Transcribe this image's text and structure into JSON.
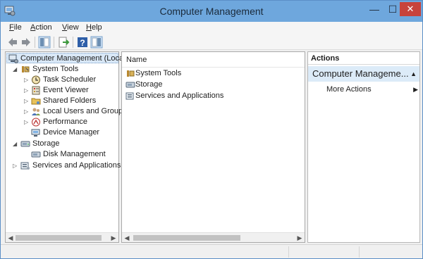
{
  "window": {
    "title": "Computer Management"
  },
  "window_controls": {
    "minimize": "—",
    "maximize": "☐",
    "close": "✕"
  },
  "menu": [
    {
      "label": "File",
      "key": "F",
      "rest": "ile"
    },
    {
      "label": "Action",
      "key": "A",
      "rest": "ction"
    },
    {
      "label": "View",
      "key": "V",
      "rest": "iew"
    },
    {
      "label": "Help",
      "key": "H",
      "rest": "elp"
    }
  ],
  "toolbar": {
    "icons": [
      "back-arrow-icon",
      "forward-arrow-icon",
      "show-hide-tree-icon",
      "export-list-icon",
      "help-icon",
      "show-hide-action-pane-icon"
    ]
  },
  "tree": {
    "root": "Computer Management (Local",
    "system_tools": "System Tools",
    "task_scheduler": "Task Scheduler",
    "event_viewer": "Event Viewer",
    "shared_folders": "Shared Folders",
    "local_users": "Local Users and Groups",
    "performance": "Performance",
    "device_manager": "Device Manager",
    "storage": "Storage",
    "disk_management": "Disk Management",
    "services": "Services and Applications"
  },
  "list": {
    "column_header": "Name",
    "items": [
      "System Tools",
      "Storage",
      "Services and Applications"
    ]
  },
  "actions": {
    "header": "Actions",
    "section": "Computer Manageme...",
    "items": [
      "More Actions"
    ]
  },
  "colors": {
    "titlebar": "#6ea7dd",
    "close": "#c7433b",
    "selection": "#dcebf8"
  }
}
